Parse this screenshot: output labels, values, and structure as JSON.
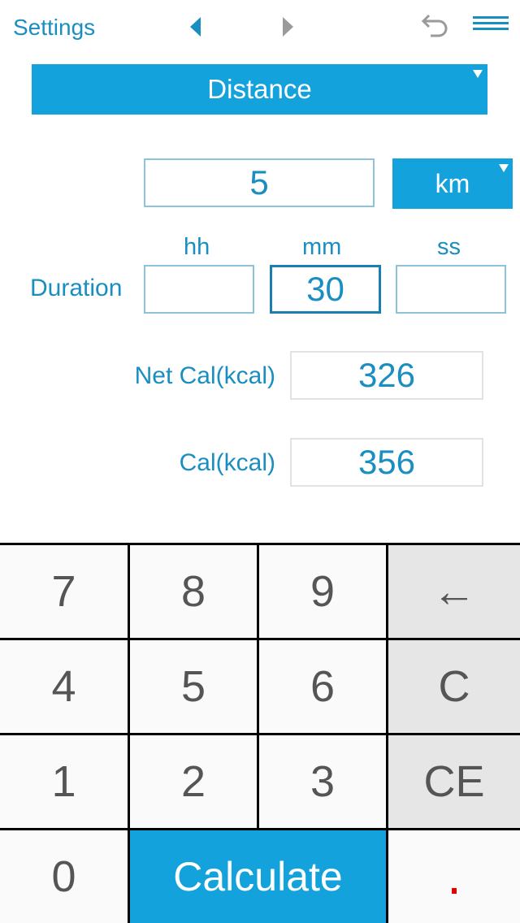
{
  "nav": {
    "settings_label": "Settings",
    "prev_icon": "triangle-left-icon",
    "next_icon": "triangle-right-icon",
    "undo_icon": "undo-icon",
    "menu_icon": "hamburger-menu-icon"
  },
  "mode": {
    "selected": "Distance"
  },
  "distance": {
    "value": "5",
    "unit": "km"
  },
  "duration": {
    "label": "Duration",
    "hh_label": "hh",
    "mm_label": "mm",
    "ss_label": "ss",
    "hh": "",
    "mm": "30",
    "ss": ""
  },
  "results": {
    "net_cal_label": "Net Cal(kcal)",
    "net_cal_value": "326",
    "cal_label": "Cal(kcal)",
    "cal_value": "356"
  },
  "keypad": {
    "k7": "7",
    "k8": "8",
    "k9": "9",
    "backspace": "←",
    "k4": "4",
    "k5": "5",
    "k6": "6",
    "clear": "C",
    "k1": "1",
    "k2": "2",
    "k3": "3",
    "clear_entry": "CE",
    "k0": "0",
    "calculate": "Calculate",
    "decimal": "."
  },
  "colors": {
    "accent": "#14a2dc",
    "text_blue": "#1a8ec0",
    "decimal_red": "#e00000"
  }
}
